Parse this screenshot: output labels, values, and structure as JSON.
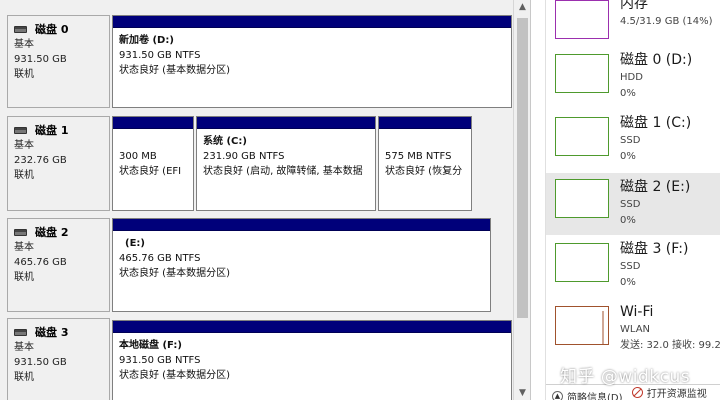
{
  "disks": [
    {
      "name": "磁盘 0",
      "type": "基本",
      "size": "931.50 GB",
      "status": "联机",
      "partitions": [
        {
          "name": "新加卷  (D:)",
          "size": "931.50 GB NTFS",
          "status": "状态良好 (基本数据分区)"
        }
      ]
    },
    {
      "name": "磁盘 1",
      "type": "基本",
      "size": "232.76 GB",
      "status": "联机",
      "partitions": [
        {
          "name": "",
          "size": "300 MB",
          "status": "状态良好 (EFI"
        },
        {
          "name": "系统  (C:)",
          "size": "231.90 GB NTFS",
          "status": "状态良好 (启动, 故障转储, 基本数据"
        },
        {
          "name": "",
          "size": "575 MB NTFS",
          "status": "状态良好 (恢复分"
        }
      ]
    },
    {
      "name": "磁盘 2",
      "type": "基本",
      "size": "465.76 GB",
      "status": "联机",
      "partitions": [
        {
          "name": "(E:)",
          "size": "465.76 GB NTFS",
          "status": "状态良好 (基本数据分区)"
        }
      ]
    },
    {
      "name": "磁盘 3",
      "type": "基本",
      "size": "931.50 GB",
      "status": "联机",
      "partitions": [
        {
          "name": "本地磁盘  (F:)",
          "size": "931.50 GB NTFS",
          "status": "状态良好 (基本数据分区)"
        }
      ]
    }
  ],
  "task_manager": {
    "items": [
      {
        "name": "内存",
        "line1": "4.5/31.9 GB (14%)",
        "line2": "",
        "color": "#9b2fae"
      },
      {
        "name": "磁盘 0 (D:)",
        "line1": "HDD",
        "line2": "0%",
        "color": "#4e9a2d"
      },
      {
        "name": "磁盘 1 (C:)",
        "line1": "SSD",
        "line2": "0%",
        "color": "#4e9a2d"
      },
      {
        "name": "磁盘 2 (E:)",
        "line1": "SSD",
        "line2": "0%",
        "color": "#4e9a2d"
      },
      {
        "name": "磁盘 3 (F:)",
        "line1": "SSD",
        "line2": "0%",
        "color": "#4e9a2d"
      },
      {
        "name": "Wi-Fi",
        "line1": "WLAN",
        "line2": "发送: 32.0  接收: 99.2",
        "color": "#a0522d"
      }
    ],
    "footer": {
      "brief": "简略信息(D)",
      "open_monitor": "打开资源监视"
    }
  },
  "watermark": "知乎 @widkcus"
}
